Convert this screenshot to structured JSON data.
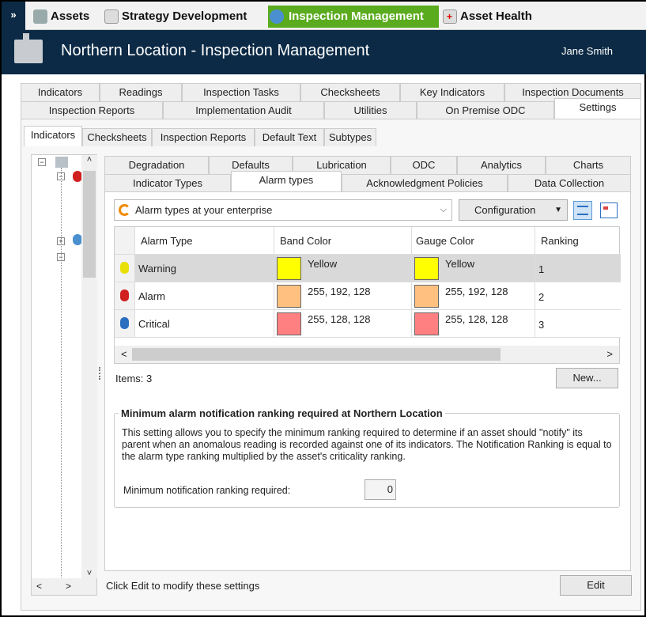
{
  "topnav": {
    "items": [
      {
        "label": "Assets"
      },
      {
        "label": "Strategy Development"
      },
      {
        "label": "Inspection Management",
        "active": true
      },
      {
        "label": "Asset Health"
      }
    ]
  },
  "header": {
    "title": "Northern Location - Inspection Management",
    "user": "Jane Smith"
  },
  "main_tabs": {
    "row1": [
      "Indicators",
      "Readings",
      "Inspection Tasks",
      "Checksheets",
      "Key Indicators",
      "Inspection Documents"
    ],
    "row2": [
      "Inspection Reports",
      "Implementation Audit",
      "Utilities",
      "On Premise ODC",
      "Settings"
    ],
    "selected": "Settings"
  },
  "settings_tabs": [
    "Indicators",
    "Checksheets",
    "Inspection Reports",
    "Default Text",
    "Subtypes"
  ],
  "indicator_tabs": {
    "row1": [
      "Degradation",
      "Defaults",
      "Lubrication",
      "ODC",
      "Analytics",
      "Charts"
    ],
    "row2": [
      "Indicator Types",
      "Alarm types",
      "Acknowledgment Policies",
      "Data Collection"
    ],
    "selected": "Alarm types"
  },
  "toolbar": {
    "scope_select": "Alarm types at your enterprise",
    "configuration": "Configuration"
  },
  "grid": {
    "columns": [
      "Alarm Type",
      "Band Color",
      "Gauge Color",
      "Ranking"
    ],
    "rows": [
      {
        "type": "Warning",
        "band": "Yellow",
        "band_hex": "#ffff00",
        "gauge": "Yellow",
        "gauge_hex": "#ffff00",
        "rank": "1",
        "icon_color": "#e8e000"
      },
      {
        "type": "Alarm",
        "band": "255, 192, 128",
        "band_hex": "#ffc080",
        "gauge": "255, 192, 128",
        "gauge_hex": "#ffc080",
        "rank": "2",
        "icon_color": "#d02020"
      },
      {
        "type": "Critical",
        "band": "255, 128, 128",
        "band_hex": "#ff8080",
        "gauge": "255, 128, 128",
        "gauge_hex": "#ff8080",
        "rank": "3",
        "icon_color": "#2a6fc0"
      }
    ]
  },
  "items_count": "Items: 3",
  "new_button": "New...",
  "group": {
    "title": "Minimum alarm notification ranking required at Northern Location",
    "description": "This setting allows you to specify the minimum ranking required to determine if an asset should \"notify\" its parent when an anomalous reading is recorded against one of its indicators.  The Notification Ranking is equal to the alarm type ranking multiplied by the asset's criticality ranking.",
    "field_label": "Minimum notification ranking required:",
    "field_value": "0"
  },
  "footer": {
    "hint": "Click Edit to modify these settings",
    "edit": "Edit"
  }
}
